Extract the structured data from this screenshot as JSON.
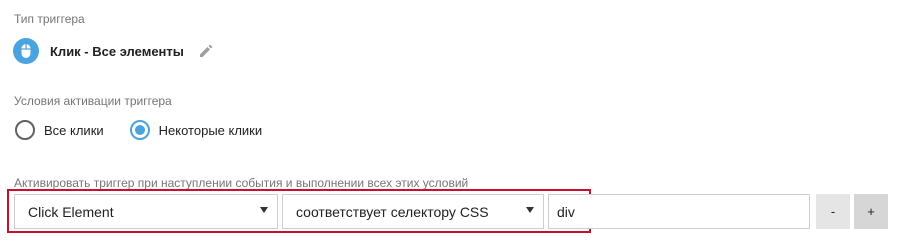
{
  "trigger_type": {
    "label": "Тип триггера",
    "name": "Клик - Все элементы",
    "icon": "mouse-icon"
  },
  "conditions": {
    "label": "Условия активации триггера",
    "options": [
      {
        "label": "Все клики",
        "selected": false
      },
      {
        "label": "Некоторые клики",
        "selected": true
      }
    ]
  },
  "fire_rules": {
    "label": "Активировать триггер при наступлении события и выполнении всех этих условий",
    "variable": "Click Element",
    "operator": "соответствует селектору CSS",
    "value": "div",
    "remove_label": "-",
    "add_label": "+"
  },
  "colors": {
    "accent": "#4aa3df",
    "highlight": "#c8102e"
  }
}
